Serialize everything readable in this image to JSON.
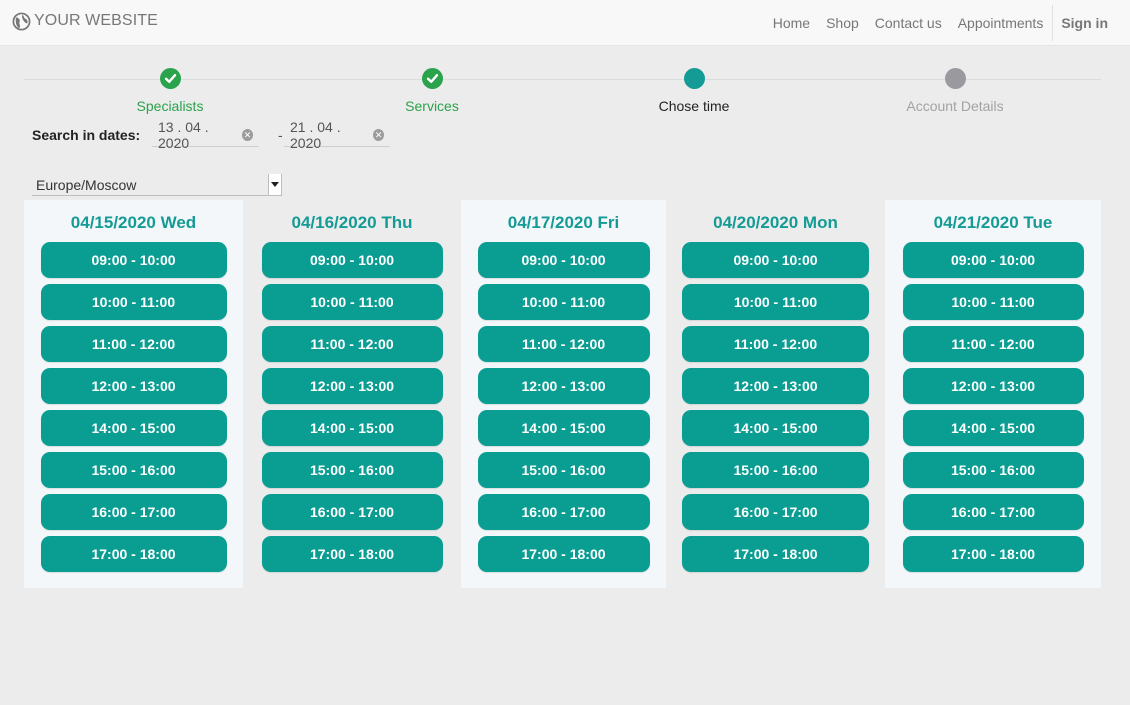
{
  "brand": {
    "text": "YOUR WEBSITE",
    "icon": "globe-icon"
  },
  "nav": {
    "links": [
      "Home",
      "Shop",
      "Contact us",
      "Appointments"
    ],
    "signin": "Sign in"
  },
  "stepper": {
    "steps": [
      {
        "label": "Specialists",
        "state": "done"
      },
      {
        "label": "Services",
        "state": "done"
      },
      {
        "label": "Chose time",
        "state": "active"
      },
      {
        "label": "Account Details",
        "state": "pending"
      }
    ]
  },
  "search": {
    "label": "Search in dates:",
    "from": "13 . 04 . 2020",
    "separator": "-",
    "to": "21 . 04 . 2020"
  },
  "timezone": {
    "selected": "Europe/Moscow"
  },
  "schedule": {
    "days": [
      {
        "title": "04/15/2020 Wed",
        "slots": [
          "09:00 - 10:00",
          "10:00 - 11:00",
          "11:00 - 12:00",
          "12:00 - 13:00",
          "14:00 - 15:00",
          "15:00 - 16:00",
          "16:00 - 17:00",
          "17:00 - 18:00"
        ]
      },
      {
        "title": "04/16/2020 Thu",
        "slots": [
          "09:00 - 10:00",
          "10:00 - 11:00",
          "11:00 - 12:00",
          "12:00 - 13:00",
          "14:00 - 15:00",
          "15:00 - 16:00",
          "16:00 - 17:00",
          "17:00 - 18:00"
        ]
      },
      {
        "title": "04/17/2020 Fri",
        "slots": [
          "09:00 - 10:00",
          "10:00 - 11:00",
          "11:00 - 12:00",
          "12:00 - 13:00",
          "14:00 - 15:00",
          "15:00 - 16:00",
          "16:00 - 17:00",
          "17:00 - 18:00"
        ]
      },
      {
        "title": "04/20/2020 Mon",
        "slots": [
          "09:00 - 10:00",
          "10:00 - 11:00",
          "11:00 - 12:00",
          "12:00 - 13:00",
          "14:00 - 15:00",
          "15:00 - 16:00",
          "16:00 - 17:00",
          "17:00 - 18:00"
        ]
      },
      {
        "title": "04/21/2020 Tue",
        "slots": [
          "09:00 - 10:00",
          "10:00 - 11:00",
          "11:00 - 12:00",
          "12:00 - 13:00",
          "14:00 - 15:00",
          "15:00 - 16:00",
          "16:00 - 17:00",
          "17:00 - 18:00"
        ]
      }
    ]
  },
  "colors": {
    "accent": "#159b95",
    "slot": "#0a9e93",
    "done": "#2ba24c",
    "pending": "#9a9a9e"
  }
}
